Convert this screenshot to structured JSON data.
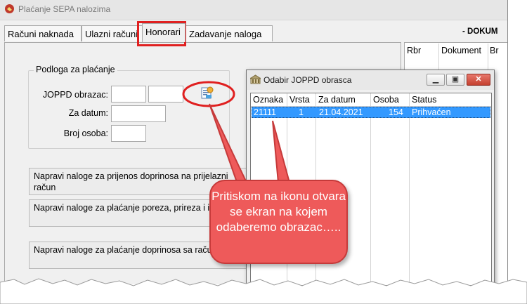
{
  "window": {
    "title": "Plaćanje SEPA nalozima",
    "header_right": "- DOKUM"
  },
  "tabs": [
    {
      "label": "Računi naknada"
    },
    {
      "label": "Ulazni računi"
    },
    {
      "label": "Honorari"
    },
    {
      "label": "Zadavanje naloga"
    }
  ],
  "podloga": {
    "legend": "Podloga za plaćanje",
    "joppd_label": "JOPPD obrazac:",
    "za_datum_label": "Za datum:",
    "broj_osoba_label": "Broj osoba:",
    "joppd_value_1": "",
    "joppd_value_2": "",
    "za_datum_value": "",
    "broj_osoba_value": "",
    "pick_icon": "select-form-icon"
  },
  "actions": [
    {
      "label": "Napravi naloge za prijenos doprinosa na prijelazni račun"
    },
    {
      "label": "Napravi naloge za plaćanje poreza, prireza i isplate"
    },
    {
      "label": "Napravi naloge za plaćanje doprinosa sa računa"
    }
  ],
  "right_grid": {
    "columns": [
      "Rbr",
      "Dokument",
      "Br"
    ]
  },
  "dialog": {
    "title": "Odabir JOPPD obrasca",
    "columns": [
      "Oznaka",
      "Vrsta",
      "Za datum",
      "Osoba",
      "Status"
    ],
    "rows": [
      {
        "oznaka": "21111",
        "vrsta": "1",
        "za_datum": "21.04.2021",
        "osoba": "154",
        "status": "Prihvaćen"
      }
    ]
  },
  "callout": {
    "text": "Pritiskom na ikonu otvara se ekran na kojem odaberemo obrazac….."
  },
  "colors": {
    "callout": "#ee5a5a",
    "highlight": "#e02020",
    "selection": "#3399ff"
  }
}
